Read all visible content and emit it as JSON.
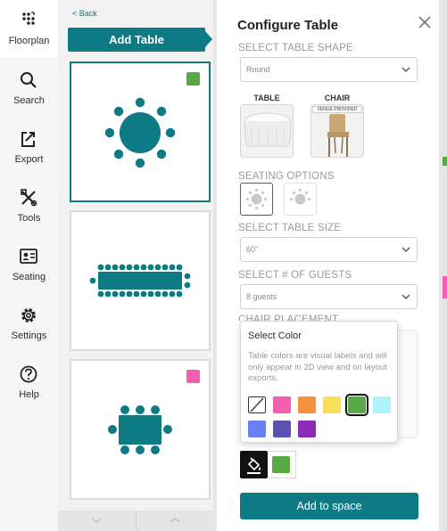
{
  "colors": {
    "teal": "#0d7a84",
    "green": "#5aa845",
    "pink": "#f25fb0"
  },
  "nav": {
    "items": [
      {
        "label": "Floorplan",
        "icon": "floorplan-icon"
      },
      {
        "label": "Search",
        "icon": "search-icon"
      },
      {
        "label": "Export",
        "icon": "export-icon"
      },
      {
        "label": "Tools",
        "icon": "tools-icon"
      },
      {
        "label": "Seating",
        "icon": "seating-icon"
      },
      {
        "label": "Settings",
        "icon": "gear-icon"
      },
      {
        "label": "Help",
        "icon": "help-icon"
      }
    ]
  },
  "list": {
    "back_label": "< Back",
    "add_table_label": "Add Table",
    "cards": [
      {
        "shape": "round",
        "tag_color": "#5aa845"
      },
      {
        "shape": "banquet",
        "tag_color": ""
      },
      {
        "shape": "rectangle",
        "tag_color": "#f25fb0"
      }
    ]
  },
  "panel": {
    "title": "Configure Table",
    "shape_section": "SELECT TABLE SHAPE",
    "shape_value": "Round",
    "table_label": "TABLE",
    "chair_label": "CHAIR",
    "chair_badge": "VENUE PROVIDED",
    "seating_section": "SEATING OPTIONS",
    "size_section": "SELECT TABLE SIZE",
    "size_value": "60\"",
    "guests_section": "SELECT # OF GUESTS",
    "guests_value": "8 guests",
    "placement_section": "CHAIR PLACEMENT",
    "add_label": "Add to space"
  },
  "color_popup": {
    "title": "Select Color",
    "description": "Table colors are visual labels and will only appear in 2D view and on layout exports.",
    "swatches": [
      "none",
      "#f25fb0",
      "#f3913c",
      "#f7e05a",
      "#5aa845",
      "#aef3fb",
      "#6a7ef5",
      "#5b51ae",
      "#8a2cb5"
    ],
    "selected_index": 4
  },
  "tools": {
    "current_color": "#5aa845"
  }
}
